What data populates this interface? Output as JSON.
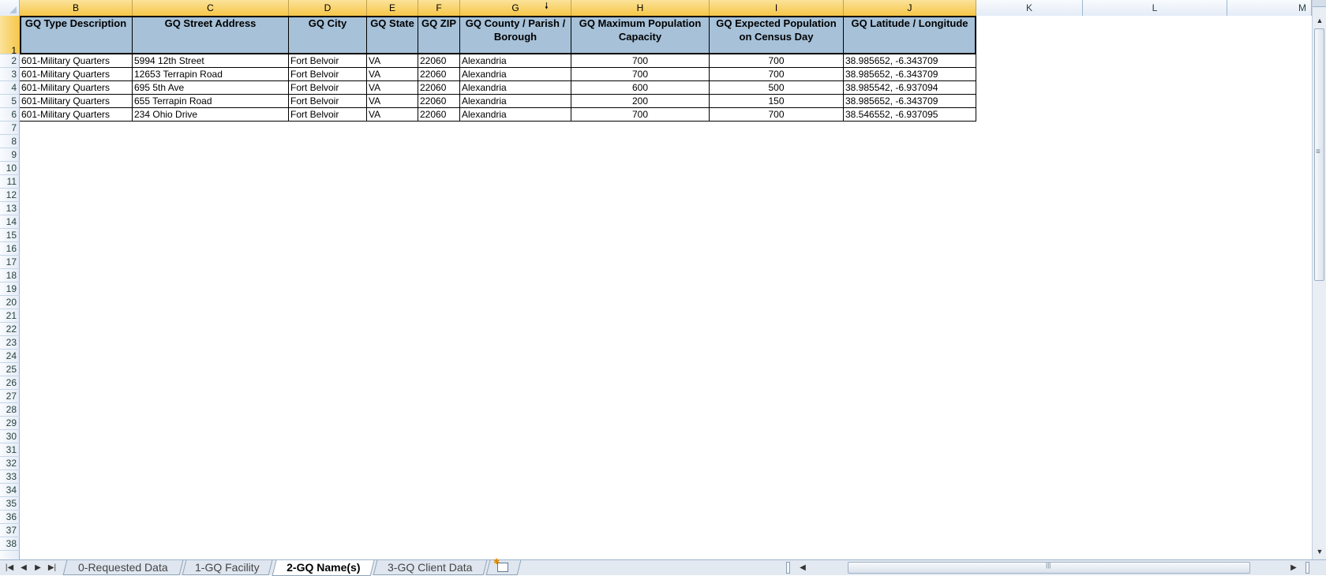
{
  "columns": [
    {
      "letter": "B",
      "selected": true
    },
    {
      "letter": "C",
      "selected": true
    },
    {
      "letter": "D",
      "selected": true
    },
    {
      "letter": "E",
      "selected": true
    },
    {
      "letter": "F",
      "selected": true
    },
    {
      "letter": "G",
      "selected": true
    },
    {
      "letter": "H",
      "selected": true
    },
    {
      "letter": "I",
      "selected": true
    },
    {
      "letter": "J",
      "selected": true
    },
    {
      "letter": "K",
      "selected": false
    },
    {
      "letter": "L",
      "selected": false
    },
    {
      "letter": "M",
      "selected": false
    }
  ],
  "row_numbers": [
    "1",
    "2",
    "3",
    "4",
    "5",
    "6",
    "7",
    "8",
    "9",
    "10",
    "11",
    "12",
    "13",
    "14",
    "15",
    "16",
    "17",
    "18",
    "19",
    "20",
    "21",
    "22",
    "23",
    "24",
    "25",
    "26",
    "27",
    "28",
    "29",
    "30",
    "31",
    "32",
    "33",
    "34",
    "35",
    "36",
    "37",
    "38"
  ],
  "selected_row": "1",
  "table": {
    "headers": [
      "GQ Type Description",
      "GQ Street Address",
      "GQ City",
      "GQ State",
      "GQ ZIP",
      "GQ County / Parish / Borough",
      "GQ Maximum Population Capacity",
      "GQ Expected Population on Census Day",
      "GQ Latitude / Longitude"
    ],
    "rows": [
      [
        "601-Military Quarters",
        "5994 12th Street",
        "Fort Belvoir",
        "VA",
        "22060",
        "Alexandria",
        "700",
        "700",
        "38.985652, -6.343709"
      ],
      [
        "601-Military Quarters",
        "12653 Terrapin Road",
        "Fort Belvoir",
        "VA",
        "22060",
        "Alexandria",
        "700",
        "700",
        "38.985652, -6.343709"
      ],
      [
        "601-Military Quarters",
        "695 5th Ave",
        "Fort Belvoir",
        "VA",
        "22060",
        "Alexandria",
        "600",
        "500",
        "38.985542, -6.937094"
      ],
      [
        "601-Military Quarters",
        "655 Terrapin Road",
        "Fort Belvoir",
        "VA",
        "22060",
        "Alexandria",
        "200",
        "150",
        "38.985652, -6.343709"
      ],
      [
        "601-Military Quarters",
        "234 Ohio Drive",
        "Fort Belvoir",
        "VA",
        "22060",
        "Alexandria",
        "700",
        "700",
        "38.546552, -6.937095"
      ]
    ]
  },
  "sheet_tabs": [
    {
      "label": "0-Requested Data",
      "active": false
    },
    {
      "label": "1-GQ Facility",
      "active": false
    },
    {
      "label": "2-GQ Name(s)",
      "active": true
    },
    {
      "label": "3-GQ Client Data",
      "active": false
    }
  ],
  "icons": {
    "sort_arrow": "down-arrow-icon",
    "insert_sheet": "insert-worksheet-icon"
  },
  "colors": {
    "header_fill": "#a6c1d8",
    "selected_column": "#f6c648"
  }
}
